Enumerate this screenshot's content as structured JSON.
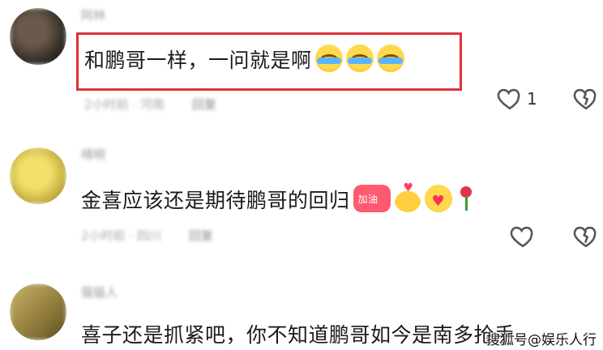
{
  "comments": [
    {
      "username": "阿林",
      "content": "和鹏哥一样，一问就是啊",
      "emojis": [
        "crying-laughing-emoji",
        "crying-laughing-emoji",
        "crying-laughing-emoji"
      ],
      "time": "2小时前 · 河南",
      "reply_label": "回复",
      "like_count": "1",
      "highlighted": true
    },
    {
      "username": "晴明",
      "content": "金喜应该还是期待鹏哥的回归",
      "emojis": [
        "cheer-emoji",
        "heart-hand-emoji",
        "hug-emoji",
        "rose-emoji"
      ],
      "time": "2小时前 · 四川",
      "reply_label": "回复",
      "like_count": "",
      "highlighted": false
    },
    {
      "username": "猫猫人",
      "content": "喜子还是抓紧吧，你不知道鹏哥如今是南多抢手",
      "emojis": [],
      "time": "",
      "reply_label": "",
      "like_count": "",
      "highlighted": false
    }
  ],
  "watermark": "搜狐号@娱乐人行",
  "colors": {
    "highlight_border": "#e0313a",
    "meta_text": "#a8a8a8",
    "body_text": "#1a1a1a"
  }
}
